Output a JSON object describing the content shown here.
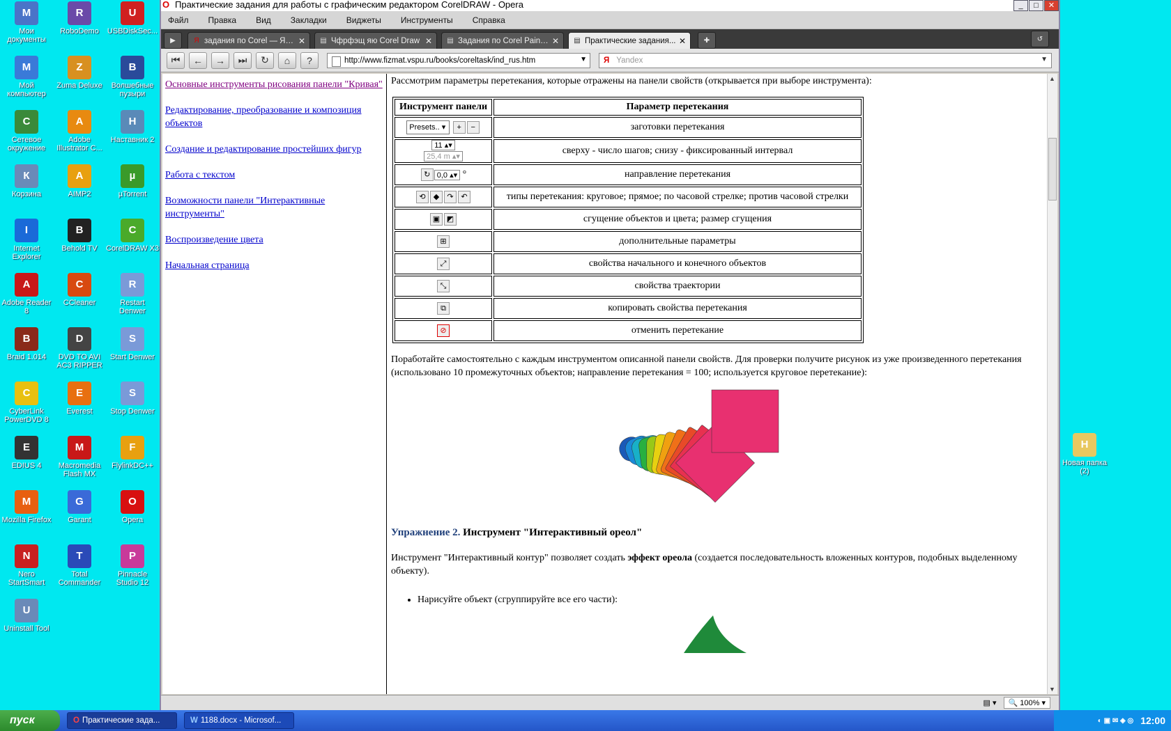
{
  "desktop_icons": [
    {
      "label": "Мои документы",
      "icon": "folder-icon",
      "color": "#4a74c8"
    },
    {
      "label": "RoboDemo",
      "icon": "play-icon",
      "color": "#6a4aa8"
    },
    {
      "label": "USBDiskSec...",
      "icon": "usb-icon",
      "color": "#d02020"
    },
    {
      "label": "Мой компьютер",
      "icon": "computer-icon",
      "color": "#3a7ad8"
    },
    {
      "label": "Zuma Deluxe",
      "icon": "zuma-icon",
      "color": "#d89020"
    },
    {
      "label": "Волшебные пузыри",
      "icon": "bubbles-icon",
      "color": "#2a4a9a"
    },
    {
      "label": "Сетевое окружение",
      "icon": "network-icon",
      "color": "#3a8a3a"
    },
    {
      "label": "Adobe Illustrator C...",
      "icon": "illustrator-icon",
      "color": "#e88a10"
    },
    {
      "label": "Наставник 2",
      "icon": "tutor-icon",
      "color": "#5a8ab8"
    },
    {
      "label": "Корзина",
      "icon": "recycle-bin-icon",
      "color": "#6a8ab8"
    },
    {
      "label": "AIMP2",
      "icon": "aimp-icon",
      "color": "#e8a010"
    },
    {
      "label": "µTorrent",
      "icon": "utorrent-icon",
      "color": "#3a9a2a"
    },
    {
      "label": "Internet Explorer",
      "icon": "ie-icon",
      "color": "#1a6ad8"
    },
    {
      "label": "Behold TV",
      "icon": "tv-icon",
      "color": "#222222"
    },
    {
      "label": "CorelDRAW X3",
      "icon": "coreldraw-icon",
      "color": "#4aaa2a"
    },
    {
      "label": "Adobe Reader 8",
      "icon": "reader-icon",
      "color": "#c81818"
    },
    {
      "label": "CCleaner",
      "icon": "ccleaner-icon",
      "color": "#d84a10"
    },
    {
      "label": "Restart Denwer",
      "icon": "denwer-icon",
      "color": "#7a9ad8"
    },
    {
      "label": "Braid 1.014",
      "icon": "braid-icon",
      "color": "#8a2a1a"
    },
    {
      "label": "DVD TO AVI AC3 RIPPER",
      "icon": "film-icon",
      "color": "#444444"
    },
    {
      "label": "Start Denwer",
      "icon": "denwer-icon",
      "color": "#7a9ad8"
    },
    {
      "label": "CyberLink PowerDVD 8",
      "icon": "dvd-icon",
      "color": "#e8c010"
    },
    {
      "label": "Everest",
      "icon": "info-icon",
      "color": "#e87010"
    },
    {
      "label": "Stop Denwer",
      "icon": "denwer-icon",
      "color": "#7a9ad8"
    },
    {
      "label": "EDIUS 4",
      "icon": "edius-icon",
      "color": "#333333"
    },
    {
      "label": "Macromedia Flash MX",
      "icon": "flash-icon",
      "color": "#c81818"
    },
    {
      "label": "FlylinkDC++",
      "icon": "butterfly-icon",
      "color": "#e8a010"
    },
    {
      "label": "Mozilla Firefox",
      "icon": "firefox-icon",
      "color": "#e86010"
    },
    {
      "label": "Garant",
      "icon": "garant-icon",
      "color": "#3a6ad8"
    },
    {
      "label": "Opera",
      "icon": "opera-icon",
      "color": "#d81010"
    },
    {
      "label": "Nero StartSmart",
      "icon": "nero-icon",
      "color": "#c82020"
    },
    {
      "label": "Total Commander",
      "icon": "floppy-icon",
      "color": "#2a4ab8"
    },
    {
      "label": "Pinnacle Studio 12",
      "icon": "pinnacle-icon",
      "color": "#c83a9a"
    },
    {
      "label": "Uninstall Tool",
      "icon": "uninstall-icon",
      "color": "#6a8ab8"
    },
    {
      "label": "Новая папка (2)",
      "icon": "folder-icon",
      "color": "#e8c860"
    }
  ],
  "window": {
    "title": "Практические задания для работы с графическим редактором CorelDRAW - Opera",
    "menu": [
      "Файл",
      "Правка",
      "Вид",
      "Закладки",
      "Виджеты",
      "Инструменты",
      "Справка"
    ],
    "tabs": [
      {
        "label": "задания по Corel — Ян...",
        "active": false,
        "fav": "Я"
      },
      {
        "label": "Чфрфэщ яю Corel Draw",
        "active": false,
        "fav": "▤"
      },
      {
        "label": "Задания по Corel Painte...",
        "active": false,
        "fav": "▤"
      },
      {
        "label": "Практические задания...",
        "active": true,
        "fav": "▤"
      }
    ],
    "address": "http://www.fizmat.vspu.ru/books/coreltask/ind_rus.htm",
    "search_placeholder": "Yandex",
    "zoom": "100%"
  },
  "sidebar_links": [
    {
      "label": "Основные инструменты рисования панели \"Кривая\"",
      "visited": true
    },
    {
      "label": "Редактирование, преобразование и композиция объектов",
      "visited": false
    },
    {
      "label": "Создание и редактирование простейших фигур",
      "visited": false
    },
    {
      "label": "Работа с текстом",
      "visited": false
    },
    {
      "label": "Возможности панели \"Интерактивные инструменты\"",
      "visited": false
    },
    {
      "label": "Воспроизведение цвета",
      "visited": false
    },
    {
      "label": "Начальная страница",
      "visited": false
    }
  ],
  "main": {
    "intro": "Рассмотрим параметры перетекания, которые отражены на панели свойств (открывается при выборе инструмента):",
    "table_headers": [
      "Инструмент панели",
      "Параметр перетекания"
    ],
    "presets_label": "Presets..",
    "steps_value": "11",
    "interval_value": "25,4 m",
    "angle_value": "0,0",
    "degree_symbol": "°",
    "table_rows": [
      "заготовки перетекания",
      "сверху - число шагов; снизу - фиксированный интервал",
      "направление перетекания",
      "типы перетекания: круговое; прямое; по часовой стрелке; против часовой стрелки",
      "сгущение объектов и цвета; размер сгущения",
      "дополнительные параметры",
      "свойства начального и конечного объектов",
      "свойства траектории",
      "копировать свойства перетекания",
      "отменить перетекание"
    ],
    "practice_text": "Поработайте самостоятельно с каждым инструментом описанной панели свойств. Для проверки получите рисунок из уже произведенного перетекания (использовано 10 промежуточных объектов; направление перетекания = 100; используется круговое перетекание):",
    "exercise_label": "Упражнение 2.",
    "exercise_title": "Инструмент \"Интерактивный ореол\"",
    "contour_text_1": "Инструмент \"Интерактивный контур\" позволяет создать",
    "contour_text_bold": "эффект ореола",
    "contour_text_2": "(создается последовательность вложенных контуров, подобных выделенному объекту).",
    "bullet": "Нарисуйте объект (сгруппируйте все его части):"
  },
  "taskbar": {
    "start": "пуск",
    "tasks": [
      "Практические зада...",
      "1188.docx - Microsof..."
    ],
    "clock": "12:00"
  }
}
